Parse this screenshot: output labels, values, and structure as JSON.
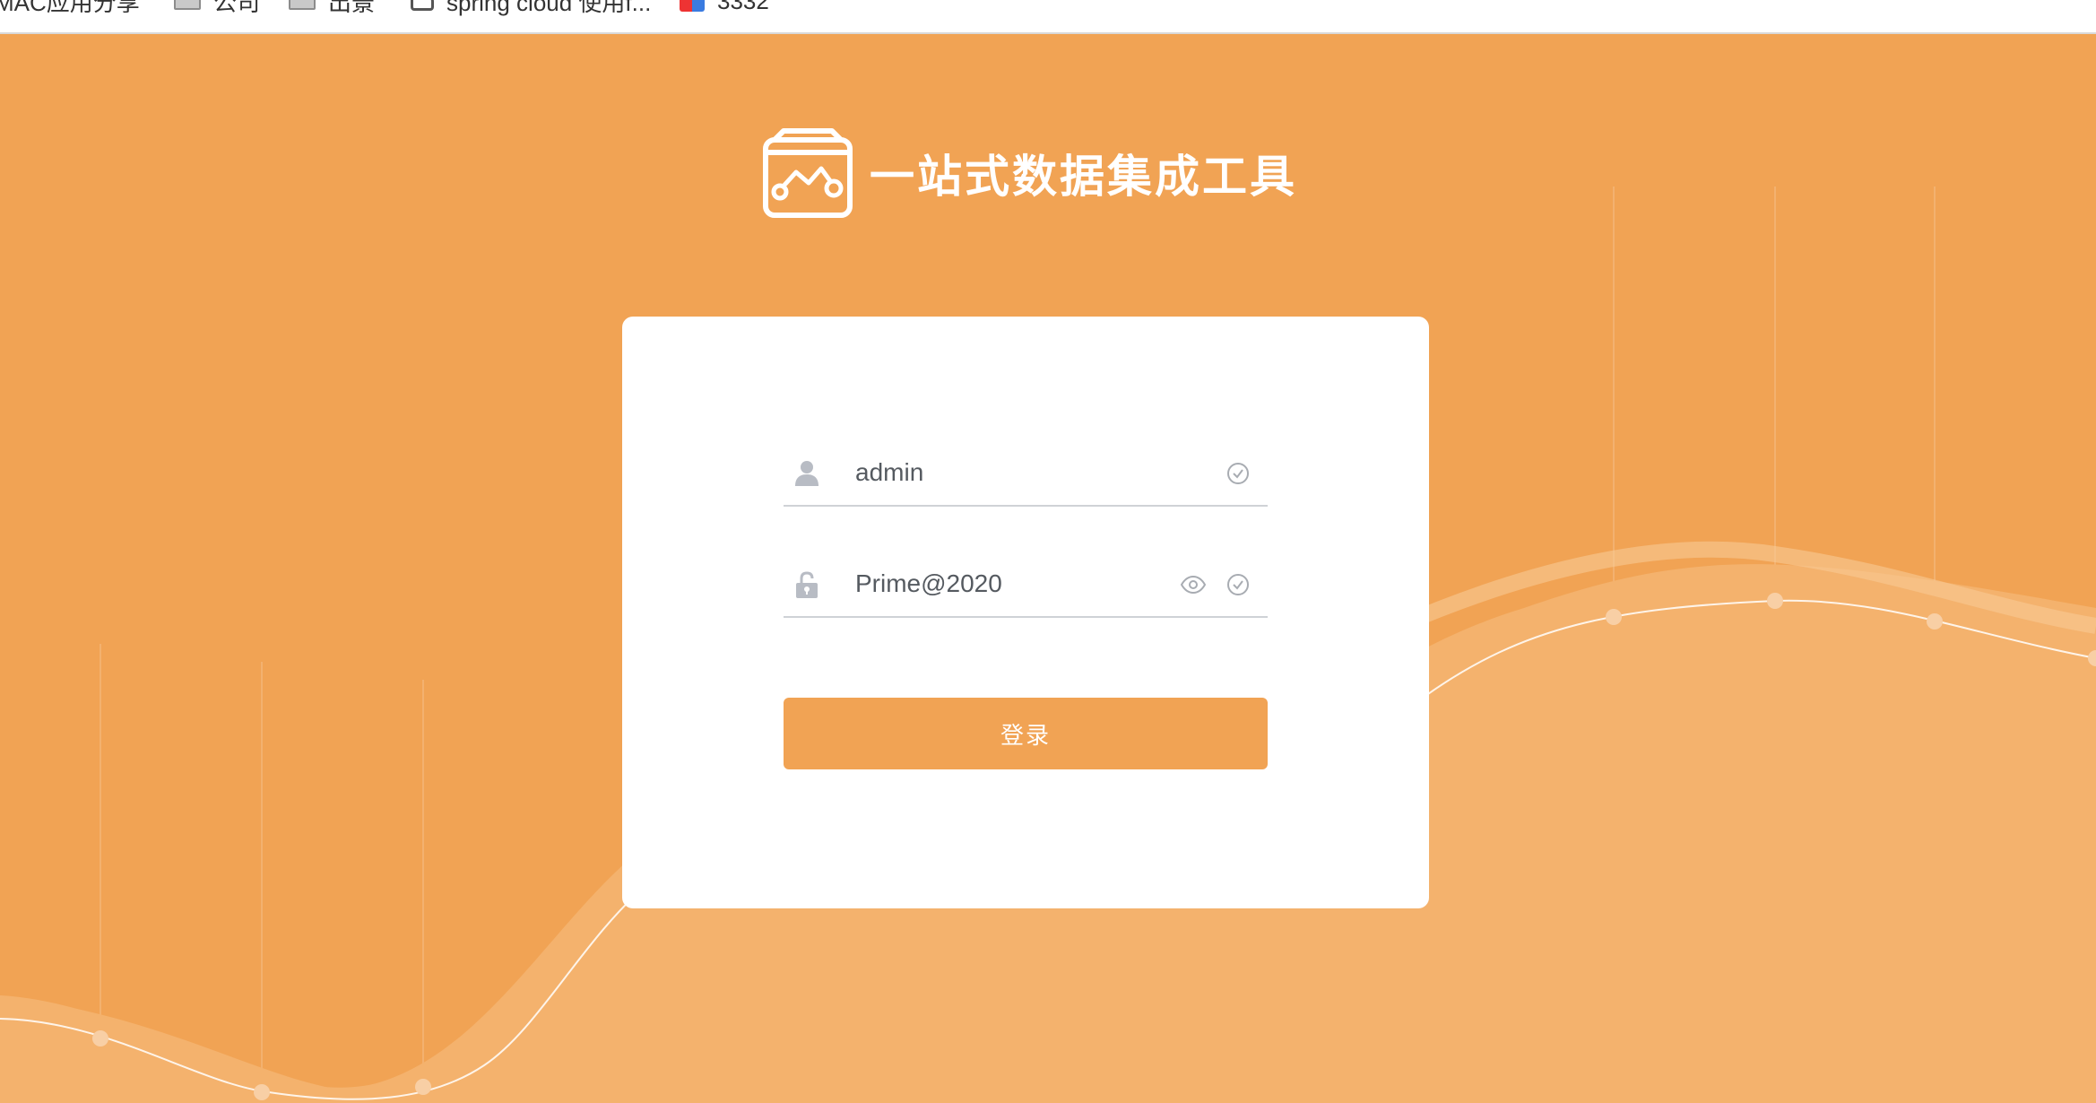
{
  "bookmarks": [
    {
      "label": "MAC应用分享",
      "icon": "app-icon"
    },
    {
      "label": "公司",
      "icon": "folder-icon"
    },
    {
      "label": "出景",
      "icon": "folder-icon"
    },
    {
      "label": "spring cloud 使用f...",
      "icon": "link-icon"
    },
    {
      "label": "3332",
      "icon": "favicon-icon"
    }
  ],
  "brand": {
    "title": "一站式数据集成工具",
    "logo_icon": "data-chart-box-icon"
  },
  "login": {
    "username_value": "admin",
    "password_value": "Prime@2020",
    "submit_label": "登录"
  },
  "colors": {
    "accent": "#f1a354",
    "accent_light": "#f4b26d",
    "card": "#ffffff",
    "icon_gray": "#b8bcc4"
  }
}
